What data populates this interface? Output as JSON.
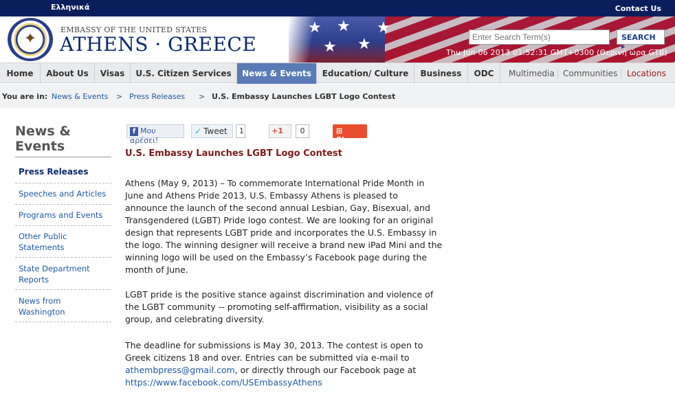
{
  "topbar": {
    "language": "Ελληνικά",
    "contact": "Contact Us"
  },
  "header": {
    "subtitle": "EMBASSY OF THE UNITED STATES",
    "title": "ATHENS · GREECE",
    "search_placeholder": "Enter Search Term(s)",
    "search_button": "SEARCH",
    "datetime": "Thu Jun 06 2013 01:52:31 GMT+0300 (Θερινή ώρα GTB)"
  },
  "nav": {
    "items": [
      "Home",
      "About Us",
      "Visas",
      "U.S. Citizen Services",
      "News & Events",
      "Education/ Culture",
      "Business",
      "ODC"
    ],
    "active": "News & Events",
    "extras": [
      "Multimedia",
      "Communities",
      "Locations"
    ]
  },
  "breadcrumb": {
    "label": "You are in:",
    "links": [
      "News & Events",
      "Press Releases"
    ],
    "current": "U.S. Embassy Launches LGBT Logo Contest"
  },
  "sidebar": {
    "title": "News & Events",
    "items": [
      "Press Releases",
      "Speeches and Articles",
      "Programs and Events",
      "Other Public Statements",
      "State Department Reports",
      "News from Washington"
    ]
  },
  "share": {
    "facebook": "Μου αρέσει!",
    "tweet": "Tweet",
    "tweet_count": "1",
    "gplus": "+1",
    "gplus_count": "0",
    "share": "Share"
  },
  "article": {
    "title": "U.S. Embassy Launches LGBT Logo Contest",
    "p1": "Athens (May 9, 2013) – To commemorate International Pride Month in June and Athens Pride 2013, U.S. Embassy Athens is pleased to announce the launch of the second annual Lesbian, Gay, Bisexual, and Transgendered (LGBT) Pride logo contest. We are looking for an original design that represents LGBT pride and incorporates the U.S. Embassy in the logo. The winning designer will receive a brand new iPad Mini and the winning logo will be used on the Embassy’s Facebook page during the month of June.",
    "p2": "LGBT pride is the positive stance against discrimination and violence of the LGBT community -- promoting self-affirmation, visibility as a social group, and celebrating diversity.",
    "p3_a": "The deadline for submissions is May 30, 2013. The contest is open to Greek citizens 18 and over. Entries can be submitted via e-mail to",
    "email": "athembpress@gmail.com",
    "p3_b": ", or directly through our Facebook page at",
    "fb_url": "https://www.facebook.com/USEmbassyAthens"
  },
  "colors": {
    "topbar": "#0b1e5c",
    "nav_active": "#5a7bb5",
    "link": "#1e5aa0",
    "title": "#7a1a1a"
  }
}
